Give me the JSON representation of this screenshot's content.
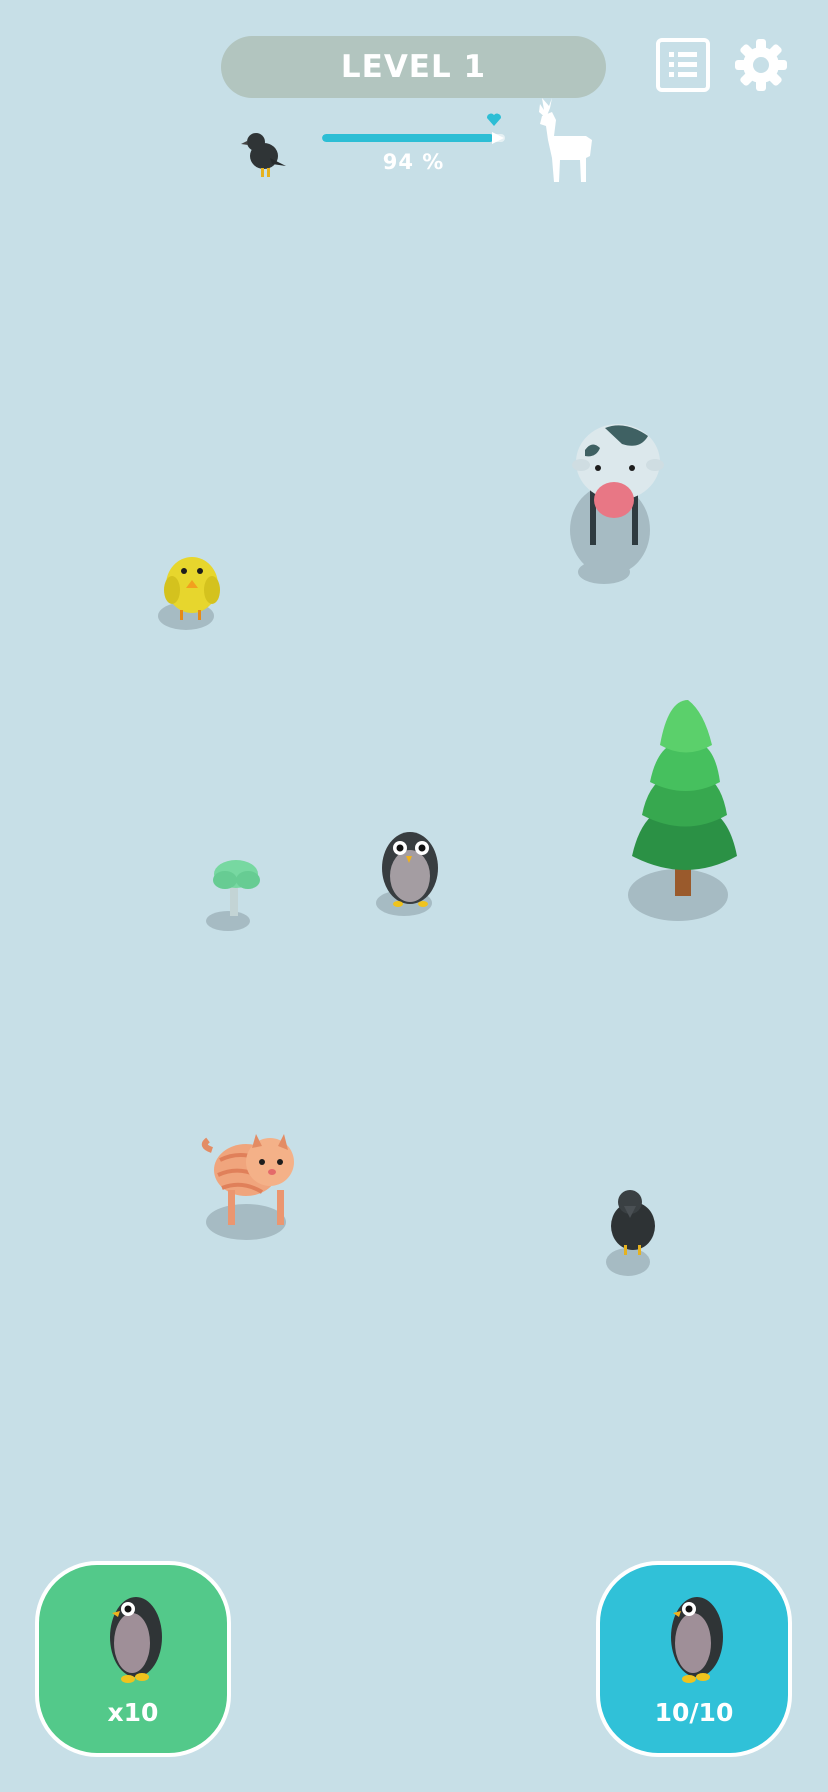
{
  "header": {
    "level_label": "LEVEL 1",
    "list_icon": "list-icon",
    "settings_icon": "gear-icon"
  },
  "progress": {
    "from_animal_icon": "crow-icon",
    "to_animal_icon": "deer-silhouette-icon",
    "marker_icon": "heart-icon",
    "percent_label": "94 %",
    "value": 0.94
  },
  "scene": {
    "objects": [
      "cow",
      "chick",
      "pine-tree",
      "penguin",
      "bush",
      "cat",
      "crow"
    ]
  },
  "buttons": {
    "spawn": {
      "icon": "penguin-icon",
      "label": "x10",
      "color": "#53c98a"
    },
    "capacity": {
      "icon": "penguin-icon",
      "label": "10/10",
      "color": "#30c1d8"
    }
  }
}
